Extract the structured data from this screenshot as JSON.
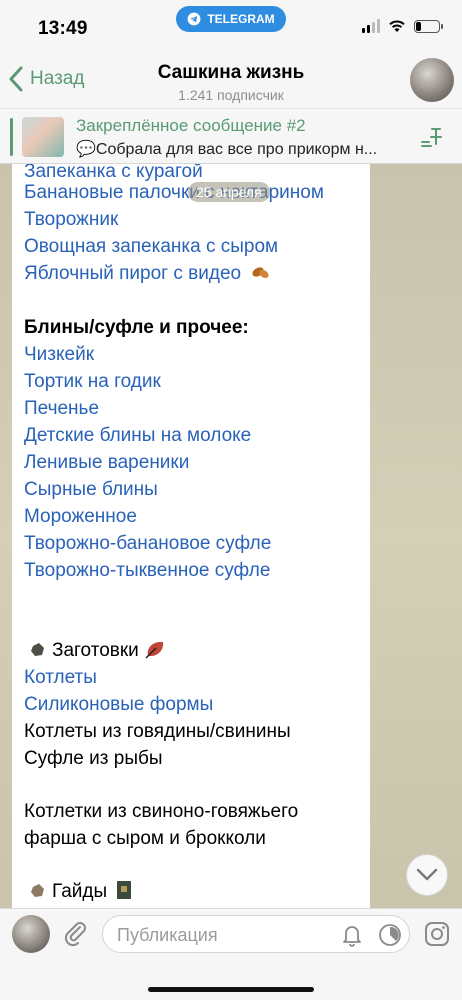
{
  "status_bar": {
    "time": "13:49",
    "telegram_label": "TELEGRAM"
  },
  "header": {
    "back_label": "Назад",
    "title": "Сашкина жизнь",
    "subtitle": "1.241 подписчик"
  },
  "pinned": {
    "title": "Закреплённое сообщение #2",
    "text": "💬Собрала для вас все про прикорм н..."
  },
  "date_badge": "25 апреля",
  "message": {
    "lines": [
      {
        "text": "Запеканка с курагой",
        "style": "link"
      },
      {
        "text": "Банановые палочки с нектарином",
        "style": "link"
      },
      {
        "text": "Творожник",
        "style": "link"
      },
      {
        "text": "Овощная запеканка с сыром",
        "style": "link"
      },
      {
        "text": "Яблочный пирог с видео",
        "style": "link"
      },
      {
        "text": "Блины/суфле и прочее:",
        "style": "bold"
      },
      {
        "text": "Чизкейк",
        "style": "link"
      },
      {
        "text": "Тортик на годик",
        "style": "link"
      },
      {
        "text": "Печенье",
        "style": "link"
      },
      {
        "text": "Детские блины на молоке",
        "style": "link"
      },
      {
        "text": "Ленивые вареники",
        "style": "link"
      },
      {
        "text": "Сырные блины",
        "style": "link"
      },
      {
        "text": "Мороженное",
        "style": "link"
      },
      {
        "text": "Творожно-банановое суфле",
        "style": "link"
      },
      {
        "text": "Творожно-тыквенное суфле",
        "style": "link"
      },
      {
        "text": "Заготовки",
        "style": "plain"
      },
      {
        "text": "Котлеты",
        "style": "link"
      },
      {
        "text": "Силиконовые формы",
        "style": "link"
      },
      {
        "text": "Котлеты из говядины/свинины",
        "style": "plain"
      },
      {
        "text": "Суфле из рыбы",
        "style": "plain"
      },
      {
        "text": "Котлетки из свиноно-говяжьего",
        "style": "plain"
      },
      {
        "text": "фарша с сыром и брокколи",
        "style": "plain"
      },
      {
        "text": "Гайды",
        "style": "plain"
      }
    ]
  },
  "bottom": {
    "input_placeholder": "Публикация"
  },
  "colors": {
    "accent": "#5a9a75",
    "link": "#2a62b8",
    "telegram": "#2e8de0"
  },
  "icons": [
    "chevron-left-icon",
    "telegram-icon",
    "pin-list-icon",
    "attach-icon",
    "bell-icon",
    "timer-icon",
    "instagram-icon",
    "chevron-down-icon"
  ]
}
